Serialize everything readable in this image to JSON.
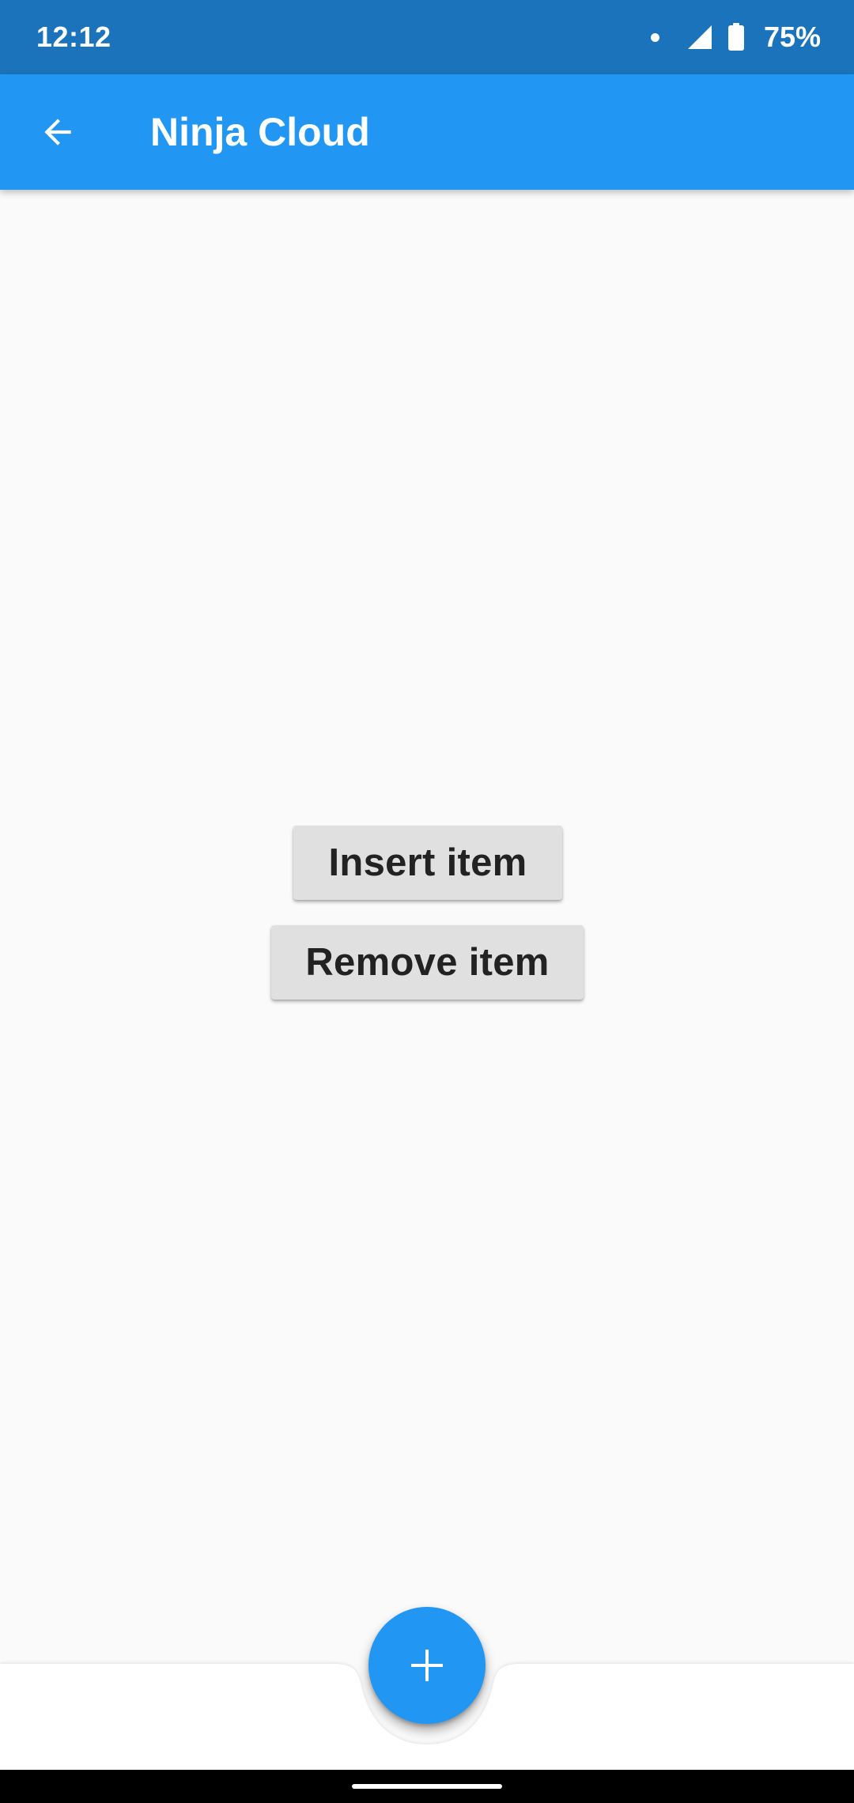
{
  "status_bar": {
    "time": "12:12",
    "battery": "75%",
    "icons": [
      "notification-dot-icon",
      "signal-icon",
      "battery-icon"
    ]
  },
  "app_bar": {
    "title": "Ninja Cloud",
    "back_icon": "arrow-back-icon",
    "color": "#2196f3"
  },
  "main": {
    "insert_label": "Insert item",
    "remove_label": "Remove item"
  },
  "fab": {
    "icon": "plus-icon",
    "color": "#2196f3"
  },
  "colors": {
    "status_bar": "#1a73bb",
    "background": "#fafafa",
    "button": "#e0e0e0",
    "bottom_bar": "#ffffff"
  }
}
